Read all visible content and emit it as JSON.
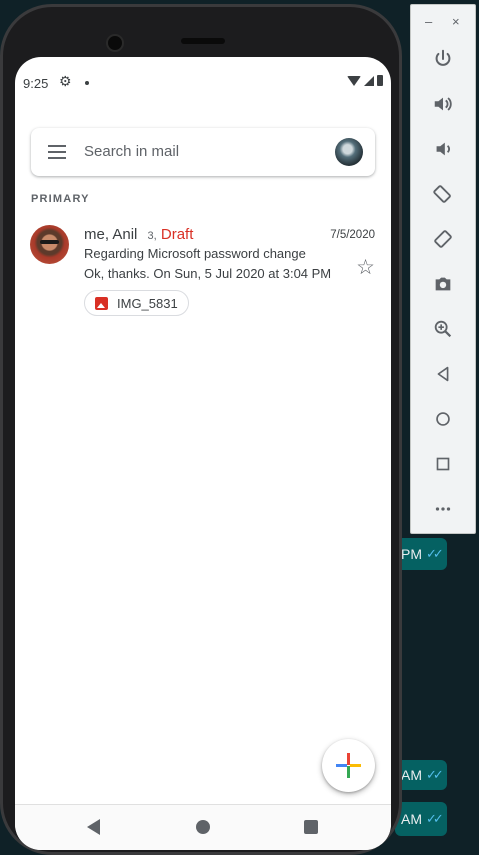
{
  "status_bar": {
    "time": "9:25"
  },
  "search": {
    "placeholder": "Search in mail"
  },
  "section_label": "PRIMARY",
  "mail": {
    "sender": "me, Anil",
    "count": "3,",
    "draft_label": "Draft",
    "date": "7/5/2020",
    "subject": "Regarding Microsoft password change",
    "snippet": "Ok, thanks. On Sun, 5 Jul 2020 at 3:04 PM",
    "attachment": "IMG_5831"
  },
  "background_chat": {
    "bubble_texts": [
      "PM",
      "AM",
      "AM"
    ]
  },
  "colors": {
    "draft": "#d93025",
    "compose_red": "#ea4335",
    "compose_green": "#34a853",
    "compose_blue": "#4285f4",
    "compose_yellow": "#fbbc04",
    "chat_bubble": "#056162"
  },
  "emulator_toolbar": {
    "minimize_label": "–",
    "close_label": "×",
    "buttons": [
      "power-icon",
      "volume-up-icon",
      "volume-down-icon",
      "rotate-left-icon",
      "rotate-right-icon",
      "camera-icon",
      "zoom-icon",
      "back-icon",
      "home-icon",
      "overview-icon",
      "more-icon"
    ]
  }
}
